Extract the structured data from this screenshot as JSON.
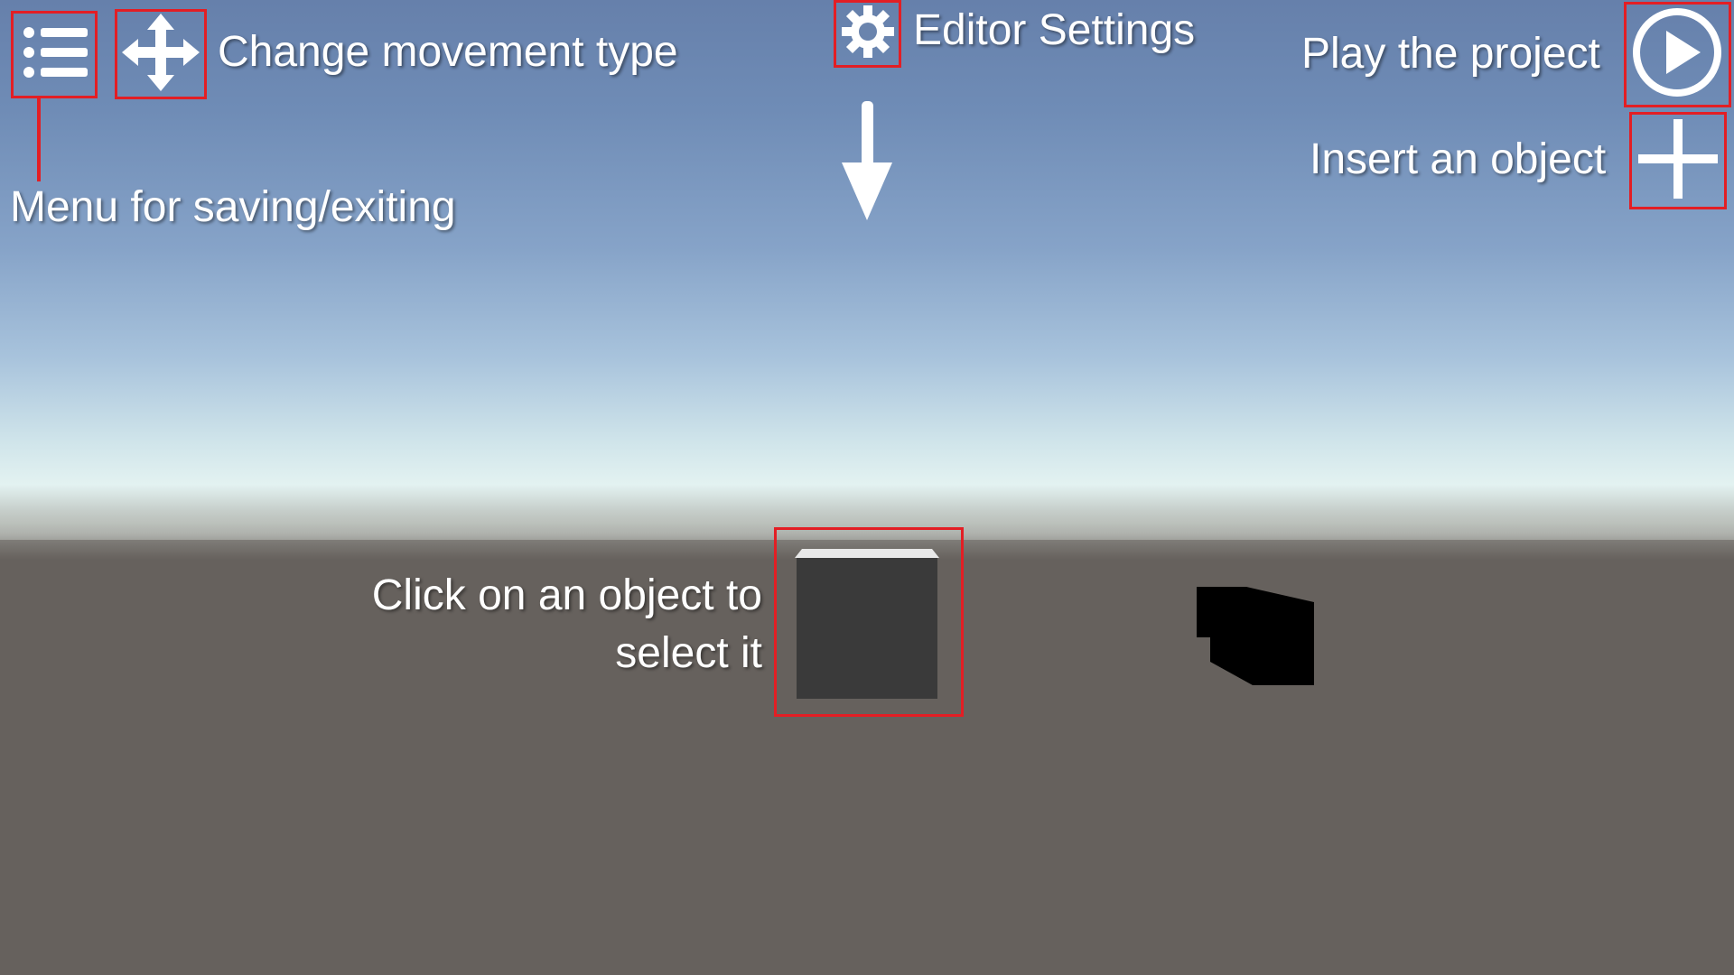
{
  "toolbar": {
    "menu_icon": "hamburger-list-icon",
    "move_icon": "four-way-arrows-icon",
    "settings_icon": "gear-icon",
    "play_icon": "play-circle-icon",
    "insert_icon": "plus-icon"
  },
  "annotations": {
    "change_movement": "Change movement type",
    "menu_saving": "Menu for saving/exiting",
    "editor_settings": "Editor Settings",
    "play_project": "Play the project",
    "insert_object": "Insert an object",
    "click_select_line1": "Click on an object to",
    "click_select_line2": "select it"
  },
  "colors": {
    "highlight": "#e31e24",
    "sky_top": "#6680ab",
    "horizon": "#e3f2f1",
    "ground": "#66615d",
    "cube": "#3a3a3a",
    "shadow_cube": "#000000",
    "icon": "#ffffff"
  }
}
